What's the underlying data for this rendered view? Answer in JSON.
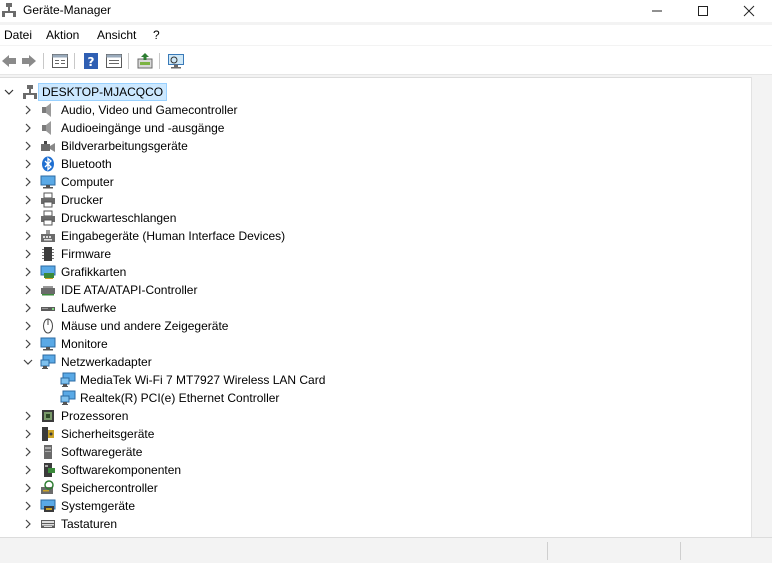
{
  "window": {
    "title": "Geräte-Manager",
    "icon": "device-manager-icon"
  },
  "menu": {
    "datei": "Datei",
    "aktion": "Aktion",
    "ansicht": "Ansicht",
    "help": "?"
  },
  "toolbar": {
    "buttons": [
      "back-arrow-icon",
      "forward-arrow-icon",
      "properties-icon",
      "help-icon",
      "show-hide-tree-icon",
      "update-driver-icon",
      "scan-hardware-icon"
    ]
  },
  "tree": {
    "root": "DESKTOP-MJACQCO",
    "categories": [
      {
        "label": "Audio, Video und Gamecontroller",
        "icon": "speaker-icon"
      },
      {
        "label": "Audioeingänge und -ausgänge",
        "icon": "speaker-icon"
      },
      {
        "label": "Bildverarbeitungsgeräte",
        "icon": "camera-icon"
      },
      {
        "label": "Bluetooth",
        "icon": "bluetooth-icon"
      },
      {
        "label": "Computer",
        "icon": "monitor-icon"
      },
      {
        "label": "Drucker",
        "icon": "printer-icon"
      },
      {
        "label": "Druckwarteschlangen",
        "icon": "printer-icon"
      },
      {
        "label": "Eingabegeräte (Human Interface Devices)",
        "icon": "hid-icon"
      },
      {
        "label": "Firmware",
        "icon": "firmware-icon"
      },
      {
        "label": "Grafikkarten",
        "icon": "display-adapter-icon"
      },
      {
        "label": "IDE ATA/ATAPI-Controller",
        "icon": "ide-controller-icon"
      },
      {
        "label": "Laufwerke",
        "icon": "drive-icon"
      },
      {
        "label": "Mäuse und andere Zeigegeräte",
        "icon": "mouse-icon"
      },
      {
        "label": "Monitore",
        "icon": "monitor-icon"
      },
      {
        "label": "Netzwerkadapter",
        "icon": "network-adapter-icon",
        "expanded": true,
        "children": [
          "MediaTek Wi-Fi 7 MT7927 Wireless LAN Card",
          "Realtek(R) PCI(e) Ethernet Controller"
        ]
      },
      {
        "label": "Prozessoren",
        "icon": "processor-icon"
      },
      {
        "label": "Sicherheitsgeräte",
        "icon": "security-device-icon"
      },
      {
        "label": "Softwaregeräte",
        "icon": "software-device-icon"
      },
      {
        "label": "Softwarekomponenten",
        "icon": "software-component-icon"
      },
      {
        "label": "Speichercontroller",
        "icon": "storage-controller-icon"
      },
      {
        "label": "Systemgeräte",
        "icon": "system-device-icon"
      },
      {
        "label": "Tastaturen",
        "icon": "keyboard-icon"
      }
    ]
  }
}
